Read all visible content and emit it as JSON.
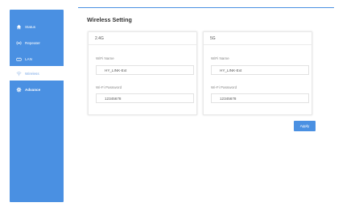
{
  "sidebar": {
    "items": [
      {
        "label": "Status",
        "icon": "home-icon"
      },
      {
        "label": "Repeater",
        "icon": "repeater-icon"
      },
      {
        "label": "LAN",
        "icon": "lan-icon"
      },
      {
        "label": "Wireless",
        "icon": "wifi-icon"
      },
      {
        "label": "Advance",
        "icon": "gear-icon"
      }
    ]
  },
  "page": {
    "title": "Wireless Setting"
  },
  "panels": [
    {
      "header": "2.4G",
      "ssid_label": "WiFi Name",
      "ssid_value": "HY_LINK-Ext",
      "password_label": "Wi-Fi Password",
      "password_value": "12345678"
    },
    {
      "header": "5G",
      "ssid_label": "WiFi Name",
      "ssid_value": "HY_LINK-Ext",
      "password_label": "Wi-Fi Password",
      "password_value": "12345678"
    }
  ],
  "actions": {
    "apply_label": "Apply"
  },
  "colors": {
    "accent": "#4a90e2",
    "active_text": "#7aa8e6"
  }
}
